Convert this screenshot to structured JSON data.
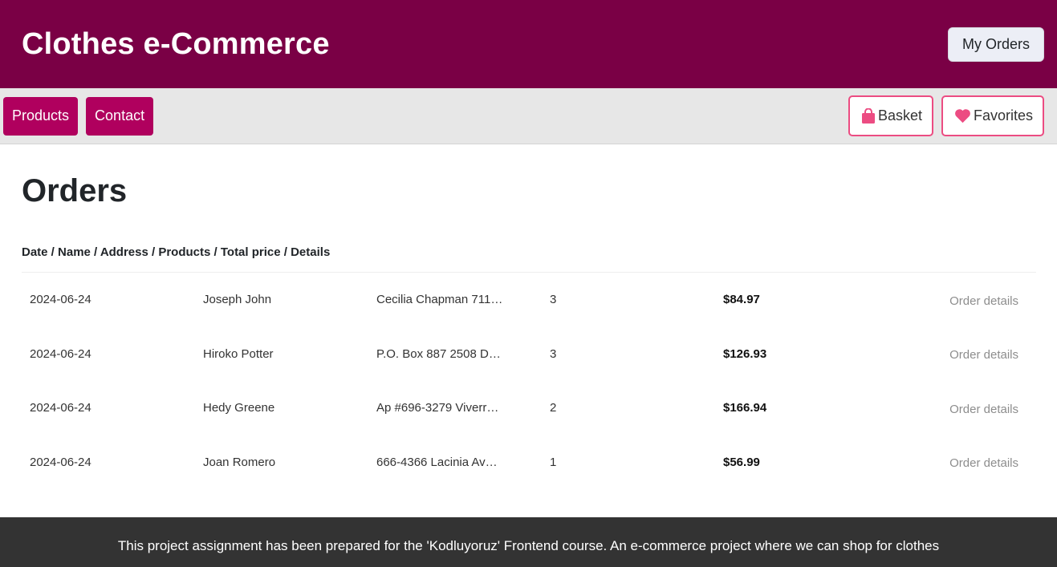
{
  "header": {
    "brand": "Clothes e-Commerce",
    "my_orders_label": "My Orders"
  },
  "nav": {
    "products_label": "Products",
    "contact_label": "Contact",
    "basket_label": "Basket",
    "favorites_label": "Favorites",
    "basket_icon": "shopping-bag-icon",
    "favorites_icon": "heart-icon",
    "accent_color": "#ec4c82"
  },
  "main": {
    "title": "Orders",
    "table_header": "Date / Name / Address / Products / Total price / Details",
    "orders": [
      {
        "date": "2024-06-24",
        "name": "Joseph John",
        "address": "Cecilia Chapman 711-…",
        "products": "3",
        "total": "$84.97",
        "details": "Order details"
      },
      {
        "date": "2024-06-24",
        "name": "Hiroko Potter",
        "address": "P.O. Box 887 2508 Do…",
        "products": "3",
        "total": "$126.93",
        "details": "Order details"
      },
      {
        "date": "2024-06-24",
        "name": "Hedy Greene",
        "address": "Ap #696-3279 Viverra…",
        "products": "2",
        "total": "$166.94",
        "details": "Order details"
      },
      {
        "date": "2024-06-24",
        "name": "Joan Romero",
        "address": "666-4366 Lacinia Ave…",
        "products": "1",
        "total": "$56.99",
        "details": "Order details"
      }
    ]
  },
  "footer": {
    "text": "This project assignment has been prepared for the 'Kodluyoruz' Frontend course. An e-commerce project where we can shop for clothes"
  },
  "colors": {
    "header_bg": "#7a0045",
    "nav_button_bg": "#b0005e",
    "footer_bg": "#333333"
  }
}
